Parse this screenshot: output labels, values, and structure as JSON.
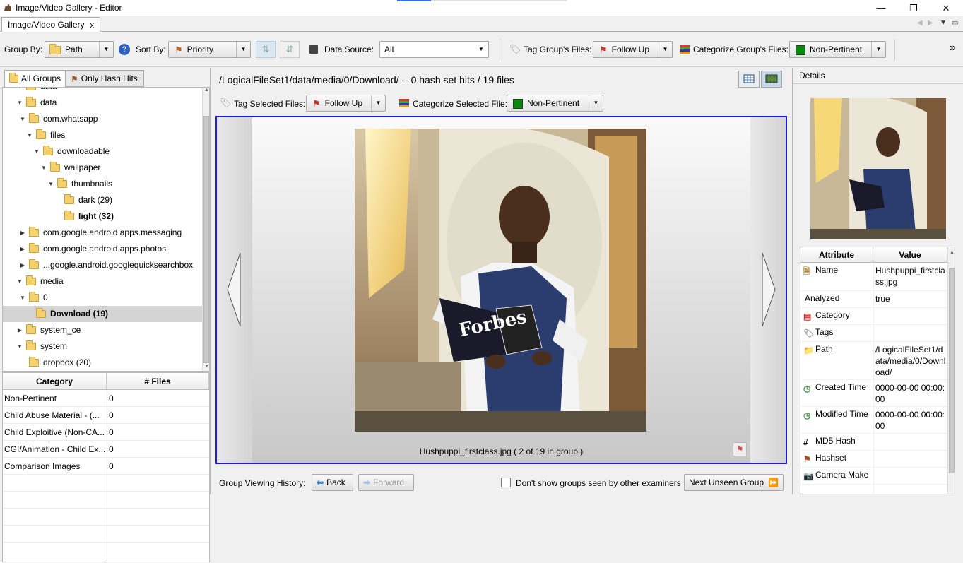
{
  "window": {
    "title": "Image/Video Gallery - Editor",
    "minimize": "—",
    "restore": "❐",
    "close": "✕"
  },
  "tabbar": {
    "tab_label": "Image/Video Gallery",
    "tab_close": "x",
    "nav_left": "◀",
    "nav_right": "▶",
    "nav_menu": "▼",
    "restore": "▭"
  },
  "toolbar": {
    "group_by_label": "Group By:",
    "group_by_value": "Path",
    "sort_by_label": "Sort By:",
    "sort_by_value": "Priority",
    "data_source_label": "Data Source:",
    "data_source_value": "All",
    "tag_group_label": "Tag Group's Files:",
    "tag_group_value": "Follow Up",
    "categorize_group_label": "Categorize Group's Files:",
    "categorize_group_value": "Non-Pertinent",
    "overflow": "»"
  },
  "left": {
    "tabs": [
      "All Groups",
      "Only Hash Hits"
    ],
    "tree": [
      {
        "label": "data",
        "depth": 1,
        "expanded": true,
        "partial": true
      },
      {
        "label": "data",
        "depth": 1,
        "expanded": true
      },
      {
        "label": "com.whatsapp",
        "depth": 2,
        "expanded": true
      },
      {
        "label": "files",
        "depth": 3,
        "expanded": true
      },
      {
        "label": "downloadable",
        "depth": 4,
        "expanded": true
      },
      {
        "label": "wallpaper",
        "depth": 5,
        "expanded": true
      },
      {
        "label": "thumbnails",
        "depth": 6,
        "expanded": true
      },
      {
        "label": "dark (29)",
        "depth": 7,
        "leaf": true
      },
      {
        "label": "light (32)",
        "depth": 7,
        "leaf": true,
        "bold": true
      },
      {
        "label": "com.google.android.apps.messaging",
        "depth": 2,
        "expanded": false
      },
      {
        "label": "com.google.android.apps.photos",
        "depth": 2,
        "expanded": false
      },
      {
        "label": "...google.android.googlequicksearchbox",
        "depth": 2,
        "expanded": false
      },
      {
        "label": "media",
        "depth": 1,
        "expanded": true
      },
      {
        "label": "0",
        "depth": 2,
        "expanded": true
      },
      {
        "label": "Download (19)",
        "depth": 3,
        "leaf": true,
        "bold": true,
        "selected": true
      },
      {
        "label": "system_ce",
        "depth": 1,
        "expanded": false
      },
      {
        "label": "system",
        "depth": 1,
        "expanded": true
      },
      {
        "label": "dropbox (20)",
        "depth": 2,
        "leaf": true
      }
    ],
    "category_table": {
      "headers": [
        "Category",
        "# Files"
      ],
      "rows": [
        {
          "category": "Non-Pertinent",
          "count": "0"
        },
        {
          "category": "Child Abuse Material - (...",
          "count": "0"
        },
        {
          "category": "Child Exploitive (Non-CA...",
          "count": "0"
        },
        {
          "category": "CGI/Animation - Child Ex...",
          "count": "0"
        },
        {
          "category": "Comparison Images",
          "count": "0"
        }
      ]
    }
  },
  "center": {
    "path_label": "/LogicalFileSet1/data/media/0/Download/ -- 0 hash set hits / 19 files",
    "tag_selected_label": "Tag Selected Files:",
    "tag_selected_value": "Follow Up",
    "categorize_selected_label": "Categorize Selected File:",
    "categorize_selected_value": "Non-Pertinent",
    "caption": "Hushpuppi_firstclass.jpg  ( 2 of 19 in group )",
    "history_label": "Group Viewing History:",
    "back_label": "Back",
    "forward_label": "Forward",
    "dont_show_label": "Don't show groups seen by other examiners",
    "next_unseen_label": "Next Unseen Group",
    "magazine_text": "Forbes"
  },
  "details": {
    "title": "Details",
    "headers": [
      "Attribute",
      "Value"
    ],
    "rows": [
      {
        "name": "Name",
        "value": "Hushpuppi_firstclass.jpg",
        "icon": "file-icon"
      },
      {
        "name": "Analyzed",
        "value": "true",
        "icon": ""
      },
      {
        "name": "Category",
        "value": "",
        "icon": "category-icon"
      },
      {
        "name": "Tags",
        "value": "",
        "icon": "tag-icon"
      },
      {
        "name": "Path",
        "value": "/LogicalFileSet1/data/media/0/Download/",
        "icon": "folder-icon"
      },
      {
        "name": "Created Time",
        "value": "0000-00-00 00:00:00",
        "icon": "clock-icon"
      },
      {
        "name": "Modified Time",
        "value": "0000-00-00 00:00:00",
        "icon": "clock-icon"
      },
      {
        "name": "MD5 Hash",
        "value": "",
        "icon": "hash-icon"
      },
      {
        "name": "Hashset",
        "value": "",
        "icon": "hashset-icon"
      },
      {
        "name": "Camera Make",
        "value": "",
        "icon": "camera-icon"
      }
    ]
  }
}
